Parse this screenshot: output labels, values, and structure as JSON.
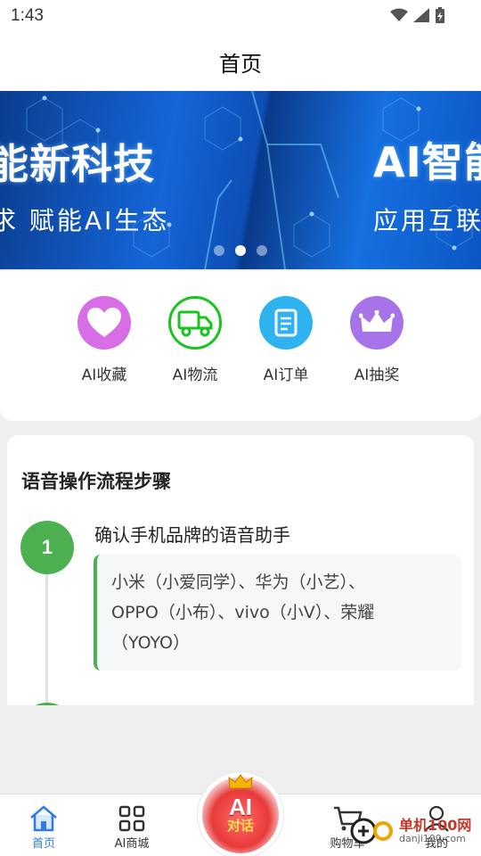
{
  "status_bar": {
    "time": "1:43"
  },
  "header": {
    "title": "首页"
  },
  "banner": {
    "slide_a_big": "能新科技",
    "slide_a_small": "求  赋能AI生态",
    "slide_b_big": "AI智能",
    "slide_b_small": "应用互联",
    "active_dot": 1
  },
  "quick_actions": [
    {
      "label": "AI收藏",
      "icon": "heart-icon",
      "color": "#d86ee6"
    },
    {
      "label": "AI物流",
      "icon": "truck-icon",
      "color": "#19c41f"
    },
    {
      "label": "AI订单",
      "icon": "document-icon",
      "color": "#2fb3f0"
    },
    {
      "label": "AI抽奖",
      "icon": "crown-icon",
      "color": "#a773e8"
    }
  ],
  "steps_card": {
    "heading": "语音操作流程步骤",
    "step1": {
      "number": "1",
      "title": "确认手机品牌的语音助手",
      "line1": "小米（小爱同学）、华为（小艺）、",
      "line2": "OPPO（小布）、vivo（小V）、荣耀",
      "line3": "（YOYO）"
    }
  },
  "tabbar": {
    "home": "首页",
    "mall": "AI商城",
    "center_ai": "AI",
    "center_sub": "对话",
    "cart": "购物车",
    "mine": "我的"
  },
  "watermark": {
    "text": "单机100网",
    "url": "danji100.com"
  },
  "colors": {
    "accent": "#2f7bea",
    "step_green": "#4caf50"
  }
}
